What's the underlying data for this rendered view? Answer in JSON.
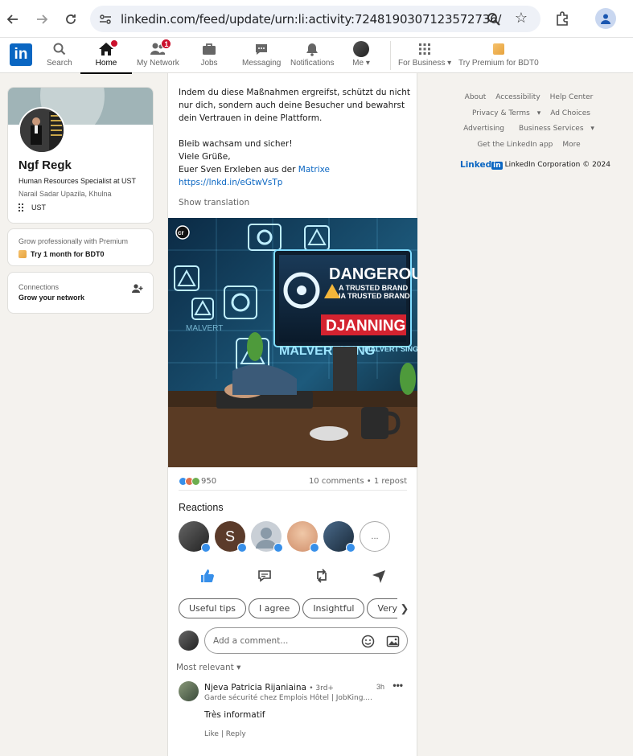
{
  "browser": {
    "url": "linkedin.com/feed/update/urn:li:activity:7248190307123572736/"
  },
  "topnav": {
    "items": [
      {
        "label": "Search",
        "icon": "search-icon"
      },
      {
        "label": "Home",
        "icon": "home-icon",
        "badge": ""
      },
      {
        "label": "My Network",
        "icon": "people-icon",
        "badge": "1"
      },
      {
        "label": "Jobs",
        "icon": "briefcase-icon"
      },
      {
        "label": "Messaging",
        "icon": "chat-icon"
      },
      {
        "label": "Notifications",
        "icon": "bell-icon"
      },
      {
        "label": "Me",
        "icon": "avatar"
      },
      {
        "label": "For Business",
        "icon": "grid-icon"
      },
      {
        "label": "Try Premium for BDT0",
        "icon": "premium-icon"
      }
    ],
    "brand_color": "#0a66c2",
    "badge_color": "#cb112d"
  },
  "profile": {
    "name": "Ngf Regk",
    "headline": "Human Resources Specialist at UST",
    "location": "Narail Sadar Upazila, Khulna",
    "org": "UST"
  },
  "premium_card": {
    "line1": "Grow professionally with Premium",
    "line2": "Try 1 month for BDT0"
  },
  "connections_card": {
    "line1": "Connections",
    "line2": "Grow your network"
  },
  "post": {
    "para1": "Indem du diese Maßnahmen ergreifst, schützt du nicht nur dich, sondern auch deine Besucher und bewahrst dein Vertrauen in deine Plattform.",
    "line_a": "Bleib wachsam und sicher!",
    "line_b": "Viele Grüße,",
    "line_c_prefix": "Euer Sven Erxleben aus der ",
    "line_c_link": "Matrixe",
    "short_link": "https://lnkd.in/eGtwVsTp",
    "show_translation": "Show translation",
    "image_text": {
      "headline1": "DANGEROUS",
      "headline2": "A TRUSTED BRAND",
      "headline3": "IA TRUSTED BRAND",
      "banner": "DJANNING",
      "malvert1": "MALVERT'SING",
      "malvert2": "MALVERT'SING",
      "side": "MALVERT",
      "logo": "cr"
    },
    "reaction_count": "950",
    "comments_reposts": "10 comments • 1 repost",
    "reactions_title": "Reactions",
    "reactor_initial": "S",
    "more_reactors": "...",
    "chips": [
      "Useful tips",
      "I agree",
      "Insightful",
      "Very helpful"
    ],
    "comment_placeholder": "Add a comment...",
    "sort_label": "Most relevant",
    "comment": {
      "author": "Njeva Patricia Rijaniaina",
      "degree": "• 3rd+",
      "time": "3h",
      "tagline": "Garde sécurité chez Emplois Hôtel | JobKing....",
      "body": "Très informatif",
      "like": "Like",
      "reply": "Reply"
    }
  },
  "footer": {
    "links": [
      "About",
      "Accessibility",
      "Help Center",
      "Privacy & Terms",
      "Ad Choices",
      "Advertising",
      "Business Services",
      "Get the LinkedIn app",
      "More"
    ],
    "brand": "Linked",
    "brand_in": "in",
    "corp": "LinkedIn Corporation © 2024"
  }
}
